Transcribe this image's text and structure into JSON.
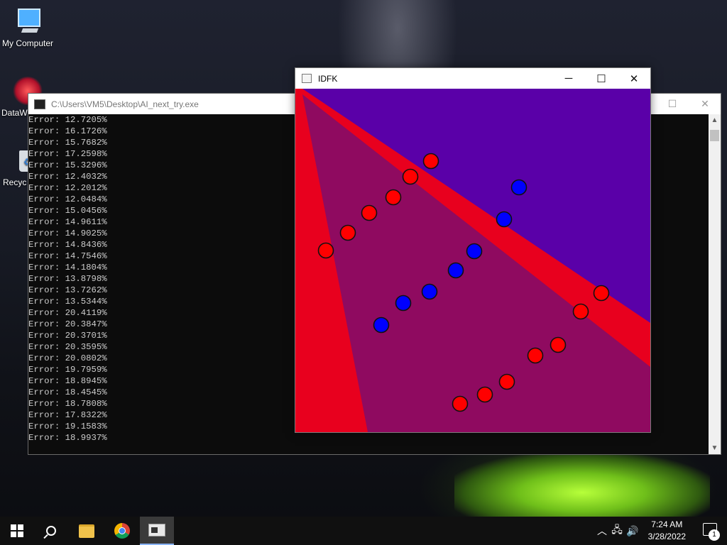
{
  "desktop": {
    "icons": [
      {
        "label": "My Computer"
      },
      {
        "label": "DataW"
      },
      {
        "label": "Recyc"
      }
    ]
  },
  "console": {
    "title": "C:\\Users\\VM5\\Desktop\\AI_next_try.exe",
    "lines": [
      "Error: 12.7205%",
      "Error: 16.1726%",
      "Error: 15.7682%",
      "Error: 17.2598%",
      "Error: 15.3296%",
      "Error: 12.4032%",
      "Error: 12.2012%",
      "Error: 12.0484%",
      "Error: 15.0456%",
      "Error: 14.9611%",
      "Error: 14.9025%",
      "Error: 14.8436%",
      "Error: 14.7546%",
      "Error: 14.1804%",
      "Error: 13.8798%",
      "Error: 13.7262%",
      "Error: 13.5344%",
      "Error: 20.4119%",
      "Error: 20.3847%",
      "Error: 20.3701%",
      "Error: 20.3595%",
      "Error: 20.0802%",
      "Error: 19.7959%",
      "Error: 18.8945%",
      "Error: 18.4545%",
      "Error: 18.7808%",
      "Error: 17.8322%",
      "Error: 19.1583%",
      "Error: 18.9937%"
    ]
  },
  "idfk_window": {
    "title": "IDFK",
    "colors": {
      "red_region": "#e8001e",
      "blue_region": "#5a00a8",
      "mixed_region": "#8f0a60",
      "red_point": "#ff0000",
      "blue_point": "#0000ff"
    }
  },
  "window_controls": {
    "minimize": "─",
    "maximize": "☐",
    "close": "✕"
  },
  "taskbar": {
    "time": "7:24 AM",
    "date": "3/28/2022",
    "notification_count": "1",
    "tray_icons": [
      "chevron-up-icon",
      "network-icon",
      "volume-icon"
    ]
  }
}
